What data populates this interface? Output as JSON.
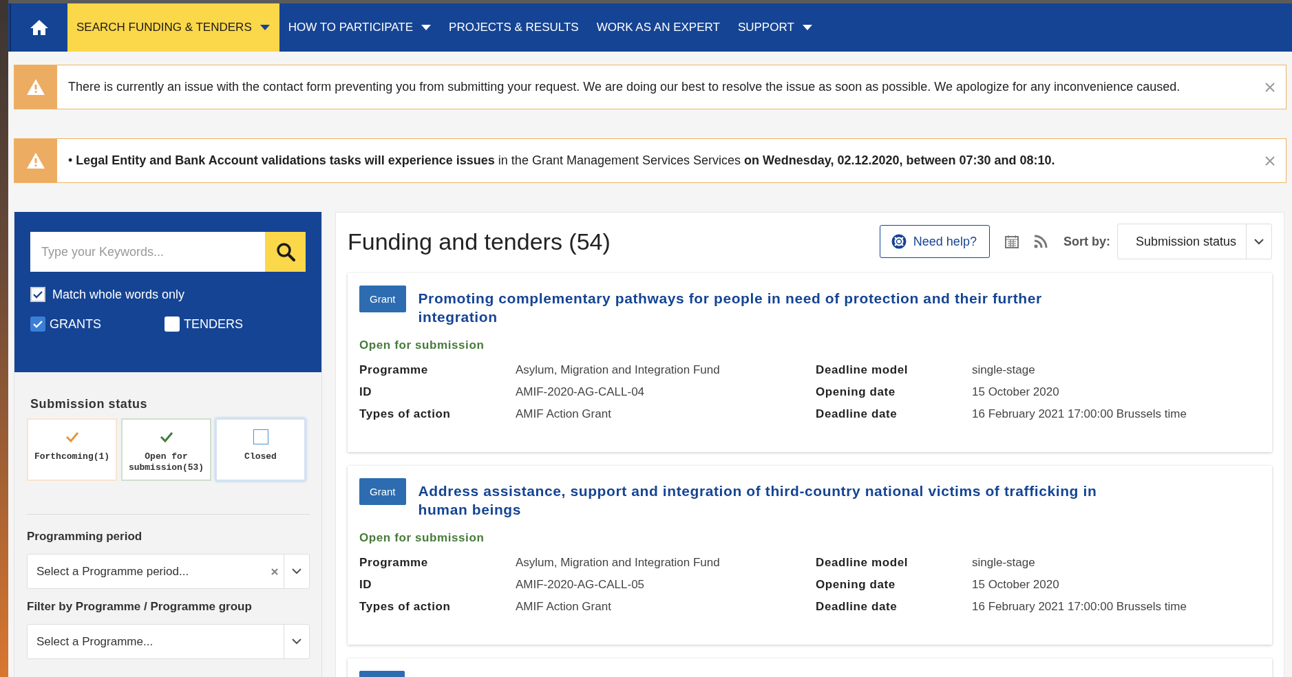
{
  "nav": {
    "items": [
      {
        "label": "SEARCH FUNDING & TENDERS",
        "selected": true,
        "has_menu": true
      },
      {
        "label": "HOW TO PARTICIPATE",
        "selected": false,
        "has_menu": true
      },
      {
        "label": "PROJECTS & RESULTS",
        "selected": false,
        "has_menu": false
      },
      {
        "label": "WORK AS AN EXPERT",
        "selected": false,
        "has_menu": false
      },
      {
        "label": "SUPPORT",
        "selected": false,
        "has_menu": true
      }
    ]
  },
  "alerts": [
    {
      "text": "There is currently an issue with the contact form preventing you from submitting your request. We are doing our best to resolve the issue as soon as possible. We apologize for any inconvenience caused."
    },
    {
      "text": "• **Legal Entity and Bank Account validations tasks will experience issues** in the Grant Management Services Services **on Wednesday, 02.12.2020, between 07:30 and 08:10.**"
    }
  ],
  "sidebar": {
    "search": {
      "placeholder": "Type your Keywords..."
    },
    "match_whole_words": {
      "label": "Match whole words only",
      "checked": true
    },
    "types": [
      {
        "label": "GRANTS",
        "checked": true
      },
      {
        "label": "TENDERS",
        "checked": false
      }
    ],
    "submission_status": {
      "title": "Submission status",
      "options": [
        {
          "label": "Forthcoming(1)",
          "checked": true,
          "color": "#e8953a"
        },
        {
          "label": "Open for submission(53)",
          "checked": true,
          "color": "#3f7d3a"
        },
        {
          "label": "Closed",
          "checked": false,
          "color": "#4a90d9"
        }
      ]
    },
    "filters": [
      {
        "label": "Programming period",
        "placeholder": "Select a Programme period...",
        "clearable": true
      },
      {
        "label": "Filter by Programme / Programme group",
        "placeholder": "Select a Programme...",
        "clearable": false
      }
    ]
  },
  "main": {
    "title": "Funding and tenders (54)",
    "help_button": "Need help?",
    "sort_label": "Sort by:",
    "sort_value": "Submission status",
    "cards": [
      {
        "badge": "Grant",
        "title": "Promoting complementary pathways for people in need of protection and their further integration",
        "status": "Open for submission",
        "fields": [
          {
            "label": "Programme",
            "value": "Asylum, Migration and Integration Fund"
          },
          {
            "label": "Deadline model",
            "value": "single-stage"
          },
          {
            "label": "ID",
            "value": "AMIF-2020-AG-CALL-04"
          },
          {
            "label": "Opening date",
            "value": "15 October 2020"
          },
          {
            "label": "Types of action",
            "value": "AMIF Action Grant"
          },
          {
            "label": "Deadline date",
            "value": "16 February 2021 17:00:00 Brussels time"
          }
        ]
      },
      {
        "badge": "Grant",
        "title": "Address assistance, support and integration of third-country national victims of trafficking in human beings",
        "status": "Open for submission",
        "fields": [
          {
            "label": "Programme",
            "value": "Asylum, Migration and Integration Fund"
          },
          {
            "label": "Deadline model",
            "value": "single-stage"
          },
          {
            "label": "ID",
            "value": "AMIF-2020-AG-CALL-05"
          },
          {
            "label": "Opening date",
            "value": "15 October 2020"
          },
          {
            "label": "Types of action",
            "value": "AMIF Action Grant"
          },
          {
            "label": "Deadline date",
            "value": "16 February 2021 17:00:00 Brussels time"
          }
        ]
      }
    ]
  }
}
